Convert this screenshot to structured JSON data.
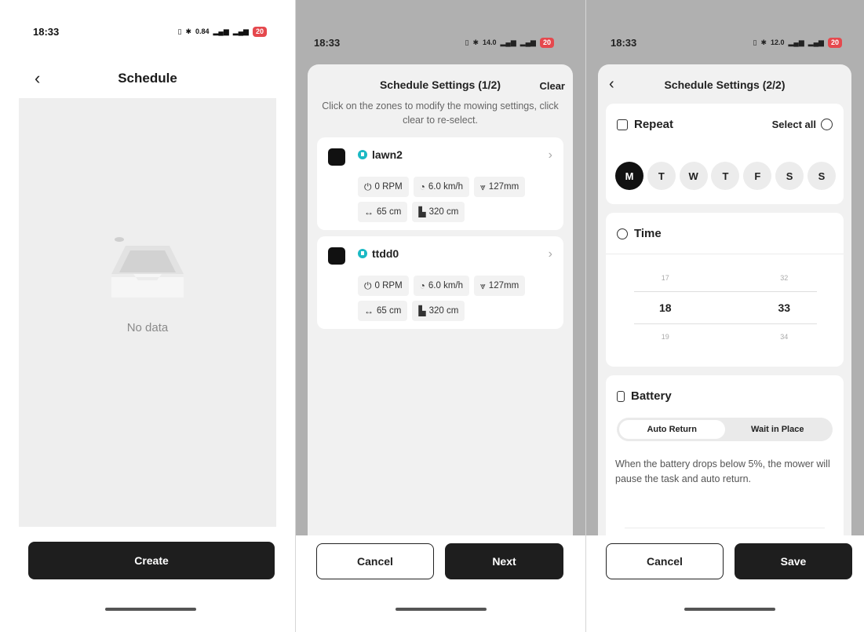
{
  "panel1": {
    "status": {
      "time": "18:33",
      "speed": "0.84",
      "battery": "20"
    },
    "title": "Schedule",
    "empty_text": "No data",
    "create_label": "Create"
  },
  "panel2": {
    "status": {
      "time": "18:33",
      "speed": "14.0",
      "battery": "20"
    },
    "title": "Schedule Settings (1/2)",
    "clear_label": "Clear",
    "subtitle": "Click on the zones to modify the mowing settings, click clear to re-select.",
    "zones": [
      {
        "name": "lawn2",
        "rpm": "0 RPM",
        "speed": "6.0 km/h",
        "height": "127mm",
        "width": "65 cm",
        "distance": "320 cm"
      },
      {
        "name": "ttdd0",
        "rpm": "0 RPM",
        "speed": "6.0 km/h",
        "height": "127mm",
        "width": "65 cm",
        "distance": "320 cm"
      }
    ],
    "cancel_label": "Cancel",
    "next_label": "Next"
  },
  "panel3": {
    "status": {
      "time": "18:33",
      "speed": "12.0",
      "battery": "20"
    },
    "title": "Schedule Settings (2/2)",
    "repeat_label": "Repeat",
    "select_all_label": "Select all",
    "days": [
      "M",
      "T",
      "W",
      "T",
      "F",
      "S",
      "S"
    ],
    "selected_day": "M",
    "time_label": "Time",
    "picker": {
      "prev_hour": "17",
      "prev_min": "32",
      "hour": "18",
      "minute": "33",
      "next_hour": "19",
      "next_min": "34"
    },
    "battery_label": "Battery",
    "battery_options": [
      "Auto Return",
      "Wait in Place"
    ],
    "battery_selected": "Auto Return",
    "battery_note": "When the battery drops below 5%, the mower will pause the task and auto return.",
    "cancel_label": "Cancel",
    "save_label": "Save"
  },
  "colors": {
    "zone_icon": "#1bb9c4",
    "battery_low": "#e5484d",
    "primary": "#1e1e1e"
  }
}
